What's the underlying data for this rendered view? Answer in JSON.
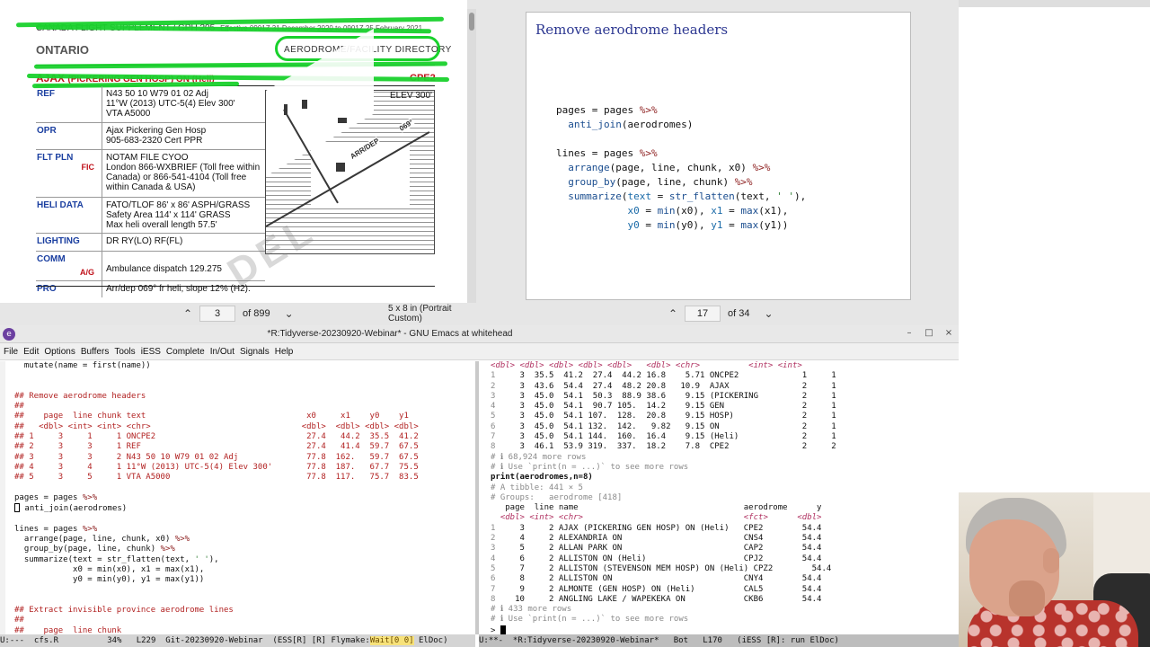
{
  "pdf_left": {
    "cfs_header": "CANADA FLIGHT SUPPLEMENT / GPH 205",
    "effective": "Effective 0901Z 31 December 2020 to 0901Z 25 February 2021",
    "province": "ONTARIO",
    "directory": "AERODROME/FACILITY DIRECTORY",
    "aerodrome_name": "AJAX",
    "aerodrome_detail": "(PICKERING GEN HOSP)  ON (Heli)",
    "aerodrome_id": "CPE2",
    "elev": "ELEV 300'",
    "rows": [
      {
        "label": "REF",
        "sub": "",
        "value": "N43 50 10 W79 01 02   Adj\n11°W (2013)   UTC-5(4)   Elev 300'\nVTA   A5000"
      },
      {
        "label": "OPR",
        "sub": "",
        "value": "Ajax Pickering Gen Hosp\n905-683-2320   Cert   PPR"
      },
      {
        "label": "FLT PLN",
        "sub": "FIC",
        "value": "NOTAM FILE CYOO\nLondon 866-WXBRIEF (Toll free within\nCanada) or 866-541-4104 (Toll free\nwithin Canada & USA)"
      },
      {
        "label": "HELI DATA",
        "sub": "",
        "value": "FATO/TLOF 86' x 86' ASPH/GRASS\nSafety Area 114' x 114' GRASS\nMax heli overall length 57.5'"
      },
      {
        "label": "LIGHTING",
        "sub": "",
        "value": "DR   RY(LO)   RF(FL)"
      },
      {
        "label": "COMM",
        "sub": "A/G",
        "value": "\nAmbulance dispatch 129.275"
      },
      {
        "label": "PRO",
        "sub": "",
        "value": "Arr/dep 069° fr heli, slope 12% (H2)."
      }
    ],
    "map_label_1": "ARR/DEP",
    "map_label_2": "069°",
    "watermark": "DEL",
    "page_current": "3",
    "page_of": "of",
    "page_total": "899",
    "page_size": "5 x 8 in (Portrait Custom)"
  },
  "pdf_right": {
    "slide_title": "Remove aerodrome headers",
    "page_current": "17",
    "page_of": "of",
    "page_total": "34"
  },
  "emacs": {
    "title": "*R:Tidyverse-20230920-Webinar* - GNU Emacs at whitehead",
    "menu": [
      "File",
      "Edit",
      "Options",
      "Buffers",
      "Tools",
      "iESS",
      "Complete",
      "In/Out",
      "Signals",
      "Help"
    ],
    "left_modeline": "U:---  cfs.R          34%   L229  Git-20230920-Webinar  (ESS[R] [R] Flymake:",
    "left_modeline_warn": "Wait[0 0]",
    "left_modeline_tail": " ElDoc)",
    "right_modeline": "U:**-  *R:Tidyverse-20230920-Webinar*   Bot   L170   (iESS [R]: run ElDoc)"
  },
  "colors": {
    "highlighter": "#19d12c",
    "aerodrome_red": "#c0121b",
    "label_blue": "#1b3fa0",
    "slide_title": "#2c3791",
    "comment": "#b22222"
  }
}
